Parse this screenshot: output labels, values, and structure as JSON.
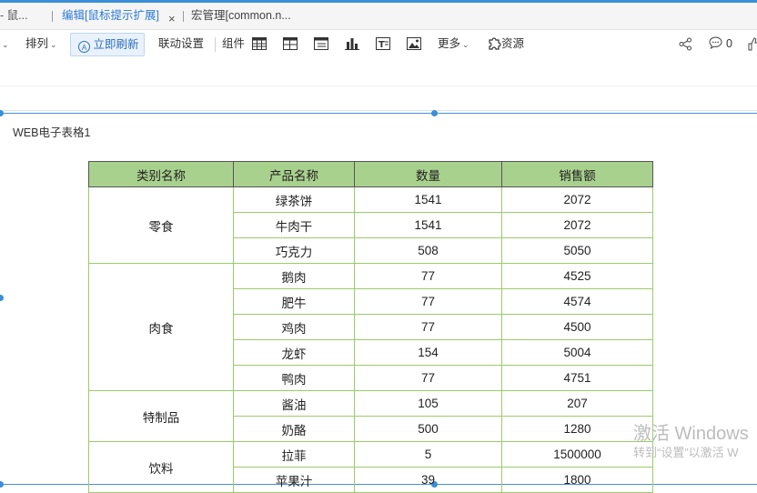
{
  "tabs": [
    {
      "label": "- 鼠..."
    },
    {
      "label": "编辑[鼠标提示扩展]",
      "close": "×"
    },
    {
      "label": "宏管理[common.n..."
    }
  ],
  "toolbar": {
    "arrange": "排列",
    "refresh": "立即刷新",
    "linkage": "联动设置",
    "components": "组件",
    "more": "更多",
    "resources": "资源",
    "comment_count": "0"
  },
  "widget": {
    "title": "WEB电子表格1"
  },
  "table": {
    "headers": [
      "类别名称",
      "产品名称",
      "数量",
      "销售额"
    ],
    "groups": [
      {
        "category": "零食",
        "rows": [
          [
            "绿茶饼",
            "1541",
            "2072"
          ],
          [
            "牛肉干",
            "1541",
            "2072"
          ],
          [
            "巧克力",
            "508",
            "5050"
          ]
        ]
      },
      {
        "category": "肉食",
        "rows": [
          [
            "鹅肉",
            "77",
            "4525"
          ],
          [
            "肥牛",
            "77",
            "4574"
          ],
          [
            "鸡肉",
            "77",
            "4500"
          ],
          [
            "龙虾",
            "154",
            "5004"
          ],
          [
            "鸭肉",
            "77",
            "4751"
          ]
        ]
      },
      {
        "category": "特制品",
        "rows": [
          [
            "酱油",
            "105",
            "207"
          ],
          [
            "奶酪",
            "500",
            "1280"
          ]
        ]
      },
      {
        "category": "饮料",
        "rows": [
          [
            "拉菲",
            "5",
            "1500000"
          ],
          [
            "苹果汁",
            "39",
            "1800"
          ]
        ]
      }
    ]
  },
  "watermark": {
    "line1": "激活 Windows",
    "line2": "转到“设置”以激活 W"
  },
  "colors": {
    "accent": "#3b8ed8",
    "tab_active": "#2d7ad6",
    "header_bg": "#a9d18e",
    "grid_border": "#9bcb6a"
  }
}
